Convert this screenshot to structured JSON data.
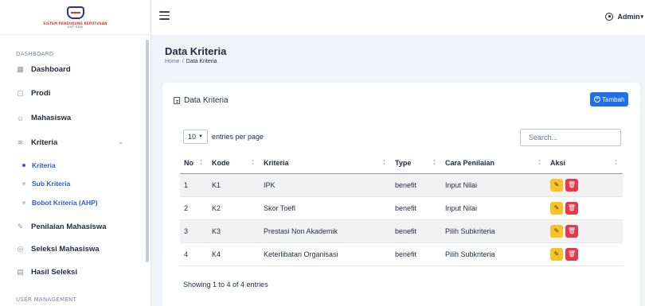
{
  "logo": {
    "text": "SISTEM PENDUKUNG KEPUTUSAN",
    "sub": "AHP SAW"
  },
  "sidebar": {
    "section_dashboard": "DASHBOARD",
    "section_user": "USER MANAGEMENT",
    "items": [
      {
        "label": "Dashboard",
        "icon": "grid-icon"
      },
      {
        "label": "Prodi",
        "icon": "window-icon"
      },
      {
        "label": "Mahasiswa",
        "icon": "users-icon"
      },
      {
        "label": "Kriteria",
        "icon": "stack-icon"
      },
      {
        "label": "Penilaian Mahasiswa",
        "icon": "edit-icon"
      },
      {
        "label": "Seleksi Mahasiswa",
        "icon": "disc-icon"
      },
      {
        "label": "Hasil Seleksi",
        "icon": "document-icon"
      }
    ],
    "sub_items": [
      {
        "label": "Kriteria",
        "active": true
      },
      {
        "label": "Sub Kriteria",
        "active": false
      },
      {
        "label": "Bobot Kriteria (AHP)",
        "active": false
      }
    ]
  },
  "topbar": {
    "user": "Admin"
  },
  "page": {
    "title": "Data Kriteria",
    "breadcrumb_home": "Home",
    "breadcrumb_sep": "/",
    "breadcrumb_current": "Data Kriteria"
  },
  "card": {
    "title": "Data Kriteria",
    "add_button": "Tambah",
    "entries_value": "10",
    "entries_label": "entries per page",
    "search_placeholder": "Search...",
    "footer": "Showing 1 to 4 of 4 entries"
  },
  "table": {
    "headers": [
      "No",
      "Kode",
      "Kriteria",
      "Type",
      "Cara Penilaian",
      "Aksi"
    ],
    "rows": [
      {
        "no": "1",
        "kode": "K1",
        "kriteria": "IPK",
        "type": "benefit",
        "cara": "Input Nilai"
      },
      {
        "no": "2",
        "kode": "K2",
        "kriteria": "Skor Toefl",
        "type": "benefit",
        "cara": "Input Nilai"
      },
      {
        "no": "3",
        "kode": "K3",
        "kriteria": "Prestasi Non Akademik",
        "type": "benefit",
        "cara": "Pilih Subkriteria"
      },
      {
        "no": "4",
        "kode": "K4",
        "kriteria": "Keterlibatan Organisasi",
        "type": "benefit",
        "cara": "Pilih Subkriteria"
      }
    ]
  },
  "colors": {
    "primary": "#1e6fe8",
    "edit": "#f7c325",
    "delete": "#e53a4b",
    "active_link": "#2d5bd6"
  }
}
